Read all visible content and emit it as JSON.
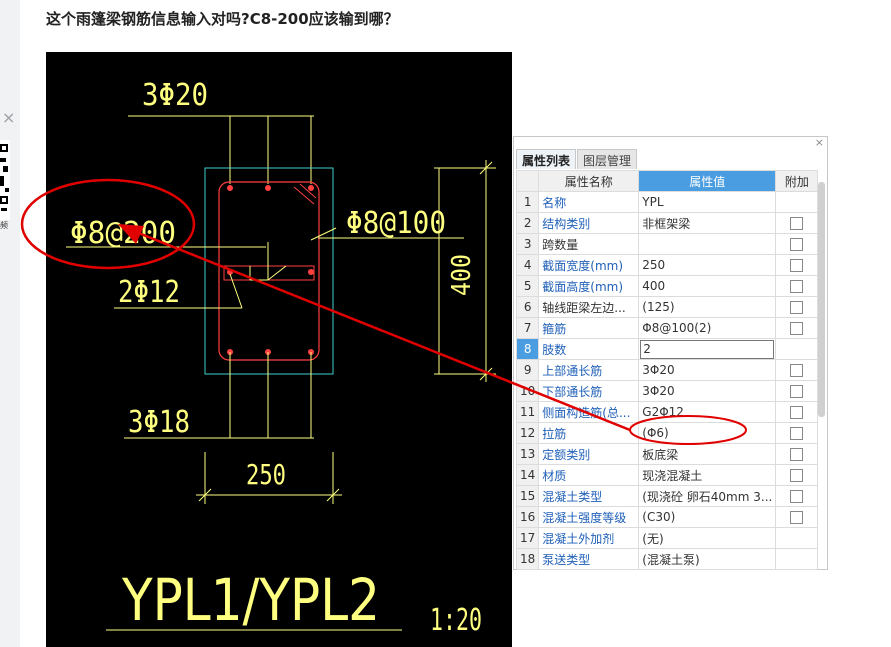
{
  "question": {
    "title": "这个雨篷梁钢筋信息输入对吗?C8-200应该输到哪？"
  },
  "drawing": {
    "top_rebar": "3Φ20",
    "stirrup_annotation": "Φ8@200",
    "side_stirrup": "Φ8@100",
    "middle_rebar": "2Φ12",
    "bottom_rebar": "3Φ18",
    "width_dim": "250",
    "height_dim": "400",
    "title": "YPL1/YPL2",
    "scale": "1:20"
  },
  "property_panel": {
    "close_label": "×",
    "tabs": [
      "属性列表",
      "图层管理"
    ],
    "columns": [
      "属性名称",
      "属性值",
      "附加"
    ],
    "rows": [
      {
        "num": "1",
        "name": "名称",
        "value": "YPL",
        "checkbox": false
      },
      {
        "num": "2",
        "name": "结构类别",
        "value": "非框架梁",
        "checkbox": true
      },
      {
        "num": "3",
        "name": "跨数量",
        "value": "",
        "checkbox": true
      },
      {
        "num": "4",
        "name": "截面宽度(mm)",
        "value": "250",
        "checkbox": true
      },
      {
        "num": "5",
        "name": "截面高度(mm)",
        "value": "400",
        "checkbox": true
      },
      {
        "num": "6",
        "name": "轴线距梁左边...",
        "value": "(125)",
        "checkbox": true
      },
      {
        "num": "7",
        "name": "箍筋",
        "value": "Φ8@100(2)",
        "checkbox": true
      },
      {
        "num": "8",
        "name": "肢数",
        "value": "2",
        "checkbox": false
      },
      {
        "num": "9",
        "name": "上部通长筋",
        "value": "3Φ20",
        "checkbox": true
      },
      {
        "num": "10",
        "name": "下部通长筋",
        "value": "3Φ20",
        "checkbox": true
      },
      {
        "num": "11",
        "name": "侧面构造筋(总...",
        "value": "G2Φ12",
        "checkbox": true
      },
      {
        "num": "12",
        "name": "拉筋",
        "value": "(Φ6)",
        "checkbox": true
      },
      {
        "num": "13",
        "name": "定额类别",
        "value": "板底梁",
        "checkbox": true
      },
      {
        "num": "14",
        "name": "材质",
        "value": "现浇混凝土",
        "checkbox": true
      },
      {
        "num": "15",
        "name": "混凝土类型",
        "value": "(现浇砼 卵石40mm 3...",
        "checkbox": true
      },
      {
        "num": "16",
        "name": "混凝土强度等级",
        "value": "(C30)",
        "checkbox": true
      },
      {
        "num": "17",
        "name": "混凝土外加剂",
        "value": "(无)",
        "checkbox": false
      },
      {
        "num": "18",
        "name": "泵送类型",
        "value": "(混凝土泵)",
        "checkbox": false
      }
    ]
  },
  "sidebar": {
    "close_label": "×",
    "qr_caption": "频"
  },
  "colors": {
    "cad_background": "#000000",
    "cad_yellow": "#ffff80",
    "cad_red": "#ff4040",
    "cad_cyan": "#40d0d0",
    "highlight_blue": "#4a9de0",
    "name_blue": "#1f5fb8",
    "annotation_red": "#e00000"
  }
}
